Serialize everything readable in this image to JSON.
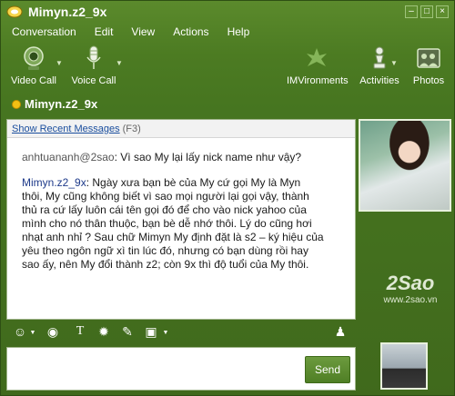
{
  "window": {
    "title": "Mimyn.z2_9x",
    "controls": [
      "minimize",
      "maximize",
      "close"
    ]
  },
  "menu": [
    "Conversation",
    "Edit",
    "View",
    "Actions",
    "Help"
  ],
  "toolbar": {
    "video_call": "Video Call",
    "voice_call": "Voice Call",
    "imvironments": "IMVironments",
    "activities": "Activities",
    "photos": "Photos"
  },
  "contact": {
    "name": "Mimyn.z2_9x",
    "status_color": "#f2c014"
  },
  "history": {
    "link": "Show Recent Messages",
    "shortcut": "(F3)"
  },
  "messages": [
    {
      "sender": "anhtuananh@2sao",
      "text": "Vì sao My lại lấy nick name như vậy?"
    },
    {
      "sender": "Mimyn.z2_9x",
      "lines": [
        ": Ngày xưa bạn bè của My cứ gọi My là Myn",
        "thôi, My cũng không biết vì sao mọi người lại gọi vậy, thành",
        "thủ ra cứ lấy luôn cái tên gọi đó để cho vào nick yahoo của",
        "mình cho nó thân thuộc, bạn bè dễ nhớ thôi. Lý do cũng hơi",
        "nhạt anh nhỉ ? Sau chữ Mimyn My định đặt là s2 – ký hiệu của",
        "yêu theo ngôn ngữ xì tin lúc đó, nhưng có bạn dùng rồi hay",
        "sao ấy, nên My đổi thành z2; còn 9x thì độ tuổi của My thôi."
      ]
    }
  ],
  "watermark": {
    "logo": "2Sao",
    "url": "www.2sao.vn"
  },
  "input": {
    "value": "",
    "send_label": "Send"
  },
  "colors": {
    "window_green": "#4c7b22",
    "self_sender": "#1e3a8a",
    "other_sender": "#555555"
  }
}
